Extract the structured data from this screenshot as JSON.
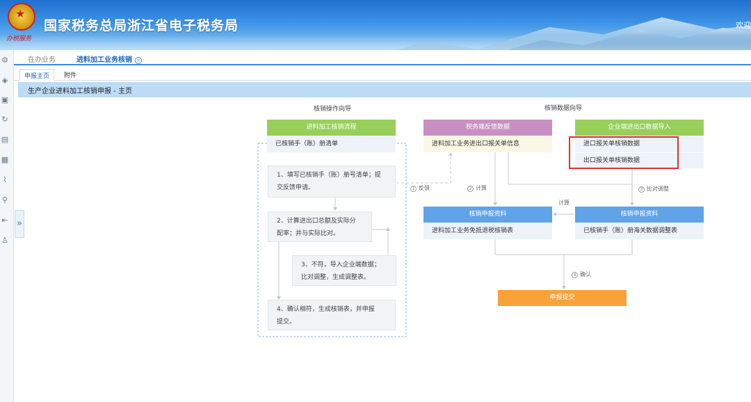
{
  "header": {
    "title": "国家税务总局浙江省电子税务局",
    "emblem_stamp": "办税服务",
    "welcome": "欢迎"
  },
  "tabs": {
    "inactive": "在办业务",
    "active": "进料加工业务核销"
  },
  "subtabs": {
    "main": "申报主页",
    "attachment": "附件"
  },
  "breadcrumb": "生产企业进料加工核销申报 - 主页",
  "guide": {
    "operation_title": "核销操作向导",
    "data_title": "核销数据向导"
  },
  "flow": {
    "title": "进料加工核销流程",
    "sub": "已核销手（账）册清单",
    "step1_line1": "1、填写已核销手（账）册号清单；提",
    "step1_line2": "交反馈申请。",
    "step2_line1": "2、计算进出口总额及实际分",
    "step2_line2": "配率；并与实际比对。",
    "step3_line1": "3、不符，导入企业端数据；",
    "step3_line2": "比对调整，生成调整表。",
    "step4_line1": "4、确认相符，生成核销表，并申报",
    "step4_line2": "提交。"
  },
  "tax_feedback": {
    "title": "税务端反馈数据",
    "item": "进料加工业务进出口报关单信息"
  },
  "enterprise_import": {
    "title": "企业端进出口数据导入",
    "item1": "进口报关单核销数据",
    "item2": "出口报关单核销数据"
  },
  "verify_info": {
    "title": "核销申报资料",
    "item": "进料加工业务免抵退税核销表"
  },
  "verify_info2": {
    "title": "核销申报资料",
    "item": "已核销手（账）册海关数据调整表"
  },
  "labels": {
    "feedback_num": "1",
    "feedback": "反馈",
    "calc_num": "2",
    "calc": "计算",
    "compare_num": "3",
    "compare": "比对调整",
    "calc2": "计算",
    "confirm_num": "4",
    "confirm": "确认"
  },
  "submit": "申报提交",
  "colors": {
    "green": "#98cf5b",
    "purple": "#c890c2",
    "blue": "#5fa3e8",
    "orange": "#f9a23a",
    "highlight": "#e03030"
  }
}
